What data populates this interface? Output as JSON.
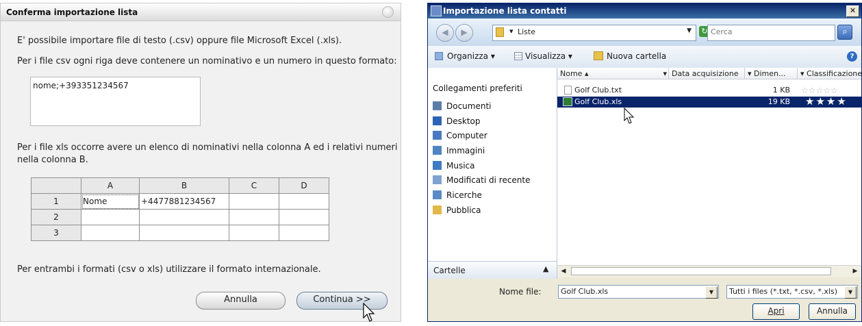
{
  "left_dialog": {
    "title": "Conferma importazione lista",
    "line1": "E' possibile importare file di testo (.csv) oppure file Microsoft Excel (.xls).",
    "line2": "Per i file csv ogni riga deve contenere un nominativo e un numero in questo formato:",
    "csv_example": "nome;+393351234567",
    "xls_text_1": "Per i file xls occorre avere un elenco di nominativi nella colonna A ed i relativi numeri",
    "xls_text_2": "nella colonna B.",
    "grid": {
      "columns": [
        "A",
        "B",
        "C",
        "D"
      ],
      "rows": [
        {
          "num": "1",
          "cells": [
            "Nome",
            "+4477881234567",
            "",
            ""
          ]
        },
        {
          "num": "2",
          "cells": [
            "",
            "",
            "",
            ""
          ]
        },
        {
          "num": "3",
          "cells": [
            "",
            "",
            "",
            ""
          ]
        }
      ]
    },
    "footer_text": "Per entrambi i formati (csv o xls) utilizzare il formato internazionale.",
    "cancel_label": "Annulla",
    "continue_label": "Continua >>"
  },
  "right_dialog": {
    "title": "Importazione lista contatti",
    "close_glyph": "✕",
    "address": "Liste",
    "search_placeholder": "Cerca",
    "toolbar": {
      "organize": "Organizza",
      "view": "Visualizza",
      "new_folder": "Nuova cartella"
    },
    "favorites_header": "Collegamenti preferiti",
    "nav_items": [
      "Documenti",
      "Desktop",
      "Computer",
      "Immagini",
      "Musica",
      "Modificati di recente",
      "Ricerche",
      "Pubblica"
    ],
    "folders_label": "Cartelle",
    "columns": [
      "Nome",
      "Data acquisizione",
      "Dimen...",
      "Classificazione"
    ],
    "files": [
      {
        "name": "Golf Club.txt",
        "size": "1 KB",
        "rating": "☆☆☆☆☆",
        "selected": false
      },
      {
        "name": "Golf Club.xls",
        "size": "19 KB",
        "rating": "★★★★",
        "selected": true
      }
    ],
    "filename_label": "Nome file:",
    "filename_value": "Golf Club.xls",
    "filter_value": "Tutti i files (*.txt, *.csv, *.xls)",
    "open_label": "Apri",
    "cancel_label": "Annulla"
  },
  "colors": {
    "selection": "#0a246a",
    "titlebar_blue": "#0a246a",
    "xp_face": "#ece9d8"
  }
}
